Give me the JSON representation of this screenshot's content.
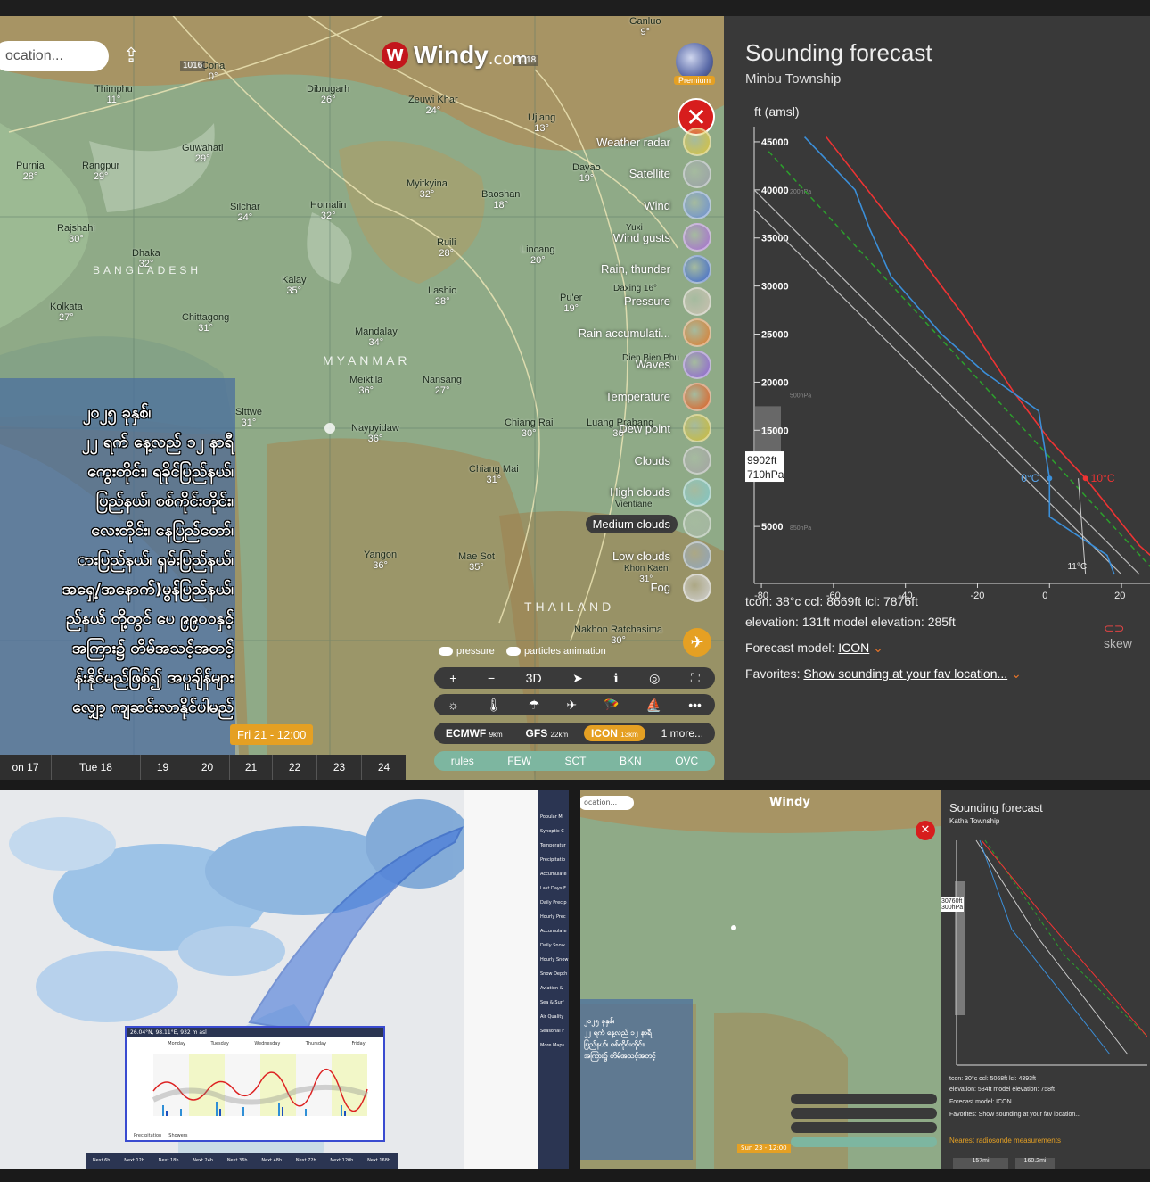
{
  "map": {
    "search_placeholder": "ocation...",
    "logo_text": "Windy",
    "logo_suffix": ".com",
    "premium_label": "Premium",
    "country_labels": [
      "MYANMAR",
      "BANGLADESH",
      "THAILAND"
    ],
    "cities": [
      {
        "name": "Thimphu",
        "temp": "11°"
      },
      {
        "name": "Dibrugarh",
        "temp": "26°"
      },
      {
        "name": "Zeuwi Khar",
        "temp": "24°"
      },
      {
        "name": "Ujiang",
        "temp": "13°"
      },
      {
        "name": "Guwahati",
        "temp": "29°"
      },
      {
        "name": "Purnia",
        "temp": "28°"
      },
      {
        "name": "Rangpur",
        "temp": "29°"
      },
      {
        "name": "Silchar",
        "temp": "24°"
      },
      {
        "name": "Homalin",
        "temp": "32°"
      },
      {
        "name": "Myitkyina",
        "temp": "32°"
      },
      {
        "name": "Baoshan",
        "temp": "18°"
      },
      {
        "name": "Dayao",
        "temp": "19°"
      },
      {
        "name": "Rajshahi",
        "temp": "30°"
      },
      {
        "name": "Dhaka",
        "temp": "32°"
      },
      {
        "name": "Ruili",
        "temp": "28°"
      },
      {
        "name": "Lincang",
        "temp": "20°"
      },
      {
        "name": "Kalay",
        "temp": "35°"
      },
      {
        "name": "Lashio",
        "temp": "28°"
      },
      {
        "name": "Pu'er",
        "temp": "19°"
      },
      {
        "name": "Kolkata",
        "temp": "27°"
      },
      {
        "name": "Chittagong",
        "temp": "31°"
      },
      {
        "name": "Mandalay",
        "temp": "34°"
      },
      {
        "name": "Meiktila",
        "temp": "36°"
      },
      {
        "name": "Nansang",
        "temp": "27°"
      },
      {
        "name": "Sittwe",
        "temp": "31°"
      },
      {
        "name": "Naypyidaw",
        "temp": "36°"
      },
      {
        "name": "Chiang Rai",
        "temp": "30°"
      },
      {
        "name": "Luang Prabang",
        "temp": "30°"
      },
      {
        "name": "Chiang Mai",
        "temp": "31°"
      },
      {
        "name": "Yangon",
        "temp": "36°"
      },
      {
        "name": "Mae Sot",
        "temp": "35°"
      },
      {
        "name": "Nakhon Ratchasima",
        "temp": "30°"
      },
      {
        "name": "Ganluo",
        "temp": "9°"
      },
      {
        "name": "Cona",
        "temp": "0°"
      },
      {
        "name": "Dien Bien Phu",
        "temp": ""
      },
      {
        "name": "Yuxi",
        "temp": ""
      },
      {
        "name": "Daxing",
        "temp": "16°"
      },
      {
        "name": "Vientiane",
        "temp": ""
      },
      {
        "name": "Khon Kaen",
        "temp": "31°"
      }
    ],
    "isobars": [
      "1016",
      "1018",
      "1016"
    ],
    "layers": [
      {
        "label": "Weather radar",
        "selected": false
      },
      {
        "label": "Satellite",
        "selected": false
      },
      {
        "label": "Wind",
        "selected": false
      },
      {
        "label": "Wind gusts",
        "selected": false
      },
      {
        "label": "Rain, thunder",
        "selected": false
      },
      {
        "label": "Pressure",
        "selected": false
      },
      {
        "label": "Rain accumulati...",
        "selected": false
      },
      {
        "label": "Waves",
        "selected": false
      },
      {
        "label": "Temperature",
        "selected": false
      },
      {
        "label": "Dew point",
        "selected": false
      },
      {
        "label": "Clouds",
        "selected": false
      },
      {
        "label": "High clouds",
        "selected": false
      },
      {
        "label": "Medium clouds",
        "selected": true
      },
      {
        "label": "Low clouds",
        "selected": false
      },
      {
        "label": "Fog",
        "selected": false
      }
    ],
    "toggles": {
      "pressure": "pressure",
      "particles": "particles animation"
    },
    "controls": [
      "+",
      "−",
      "3D",
      "➤",
      "ℹ",
      "◎",
      "⛶"
    ],
    "tools": [
      "☼",
      "🌡",
      "☂",
      "✈",
      "🪂",
      "⛵",
      "•••"
    ],
    "models": [
      {
        "label": "ECMWF",
        "res": "9km",
        "on": false
      },
      {
        "label": "GFS",
        "res": "22km",
        "on": false
      },
      {
        "label": "ICON",
        "res": "13km",
        "on": true
      },
      {
        "label": "1 more...",
        "res": "",
        "on": false
      }
    ],
    "cloud_scale": [
      "rules",
      "FEW",
      "SCT",
      "BKN",
      "OVC"
    ],
    "time_flag": "Fri 21 - 12:00",
    "timeline": [
      "on 17",
      "Tue 18",
      "19",
      "20",
      "21",
      "22",
      "23",
      "24"
    ]
  },
  "overlay": {
    "lines": [
      "၂၀၂၅ ခုနှစ်၊",
      "၂၂ ရက် နေ့လည် ၁၂ နာရီ",
      "ကွေးတိုင်း၊ ရခိုင်ပြည်နယ်၊",
      "ပြည်နယ်၊ စစ်ကိုင်းတိုင်း၊",
      "လေးတိုင်း၊ နေပြည်တော်၊",
      "ားပြည်နယ်၊ ရှမ်းပြည်နယ်၊",
      "အရှေ့/အနောက်)မွန်ပြည်နယ်၊",
      "ည်နယ် တို့တွင် ပေ ၉၉၀၀နှင့်",
      "အကြား၌ တိမ်အသင့်အတင့်",
      "န်းနိုင်မည်ဖြစ်၍ အပူချိန်များ",
      "လျှော့ ကျဆင်းလာနိုင်ပါမည်"
    ]
  },
  "sounding": {
    "title": "Sounding forecast",
    "location": "Minbu Township",
    "axis_unit": "ft (amsl)",
    "alt_ticks": [
      "45000",
      "40000",
      "35000",
      "30000",
      "25000",
      "20000",
      "15000",
      "5000"
    ],
    "hpa_labels": [
      "200hPa",
      "500hPa",
      "850hPa"
    ],
    "temp_ticks": [
      "-80",
      "-60",
      "-40",
      "-20",
      "0",
      "20"
    ],
    "cursor": {
      "alt": "9902ft",
      "p": "710hPa"
    },
    "isotherms": [
      "0°C",
      "10°C",
      "11°C"
    ],
    "tcon": "tcon: 38°c ccl: 8669ft lcl: 7876ft",
    "elevation": "elevation: 131ft model elevation: 285ft",
    "forecast_model_label": "Forecast model:",
    "forecast_model": "ICON",
    "favorites_label": "Favorites:",
    "favorites": "Show sounding at your fav location...",
    "skew": "skew"
  },
  "bottom_left": {
    "popup_title": "26.04°N, 98.11°E, 932 m asl",
    "days": [
      "Monday",
      "Tuesday",
      "Wednesday",
      "Thursday",
      "Friday"
    ],
    "legend": [
      "Precipitation",
      "Showers"
    ],
    "nav": [
      "Next 6h",
      "Next 12h",
      "Next 18h",
      "Next 24h",
      "Next 36h",
      "Next 48h",
      "Next 72h",
      "Next 120h",
      "Next 168h"
    ],
    "menu": [
      "Popular M",
      "Synoptic C",
      "Temperatur",
      "Precipitatio",
      "Accumulate",
      "Last Days F",
      "Daily Precip",
      "Hourly Prec",
      "Accumulate",
      "Daily Snow",
      "Hourly Snow",
      "Snow Depth",
      "Aviation &",
      "Sea & Surf",
      "Air Quality",
      "Seasonal F",
      "More Maps"
    ]
  },
  "bottom_right": {
    "title": "Sounding forecast",
    "location": "Katha Township",
    "cursor_alt": "30760ft",
    "cursor_p": "300hPa",
    "tcon": "tcon: 30°c ccl: 5068ft lcl: 4393ft",
    "elevation": "elevation: 584ft model elevation: 758ft",
    "model": "Forecast model: ICON",
    "favorites": "Favorites: Show sounding at your fav location...",
    "radiosonde": "Nearest radiosonde measurements",
    "distances": [
      "157mi",
      "160.2mi"
    ],
    "time_flag": "Sun 23 - 12:00"
  },
  "colors": {
    "accent": "#e5a023",
    "close": "#d71d1d",
    "panel": "#393939"
  }
}
